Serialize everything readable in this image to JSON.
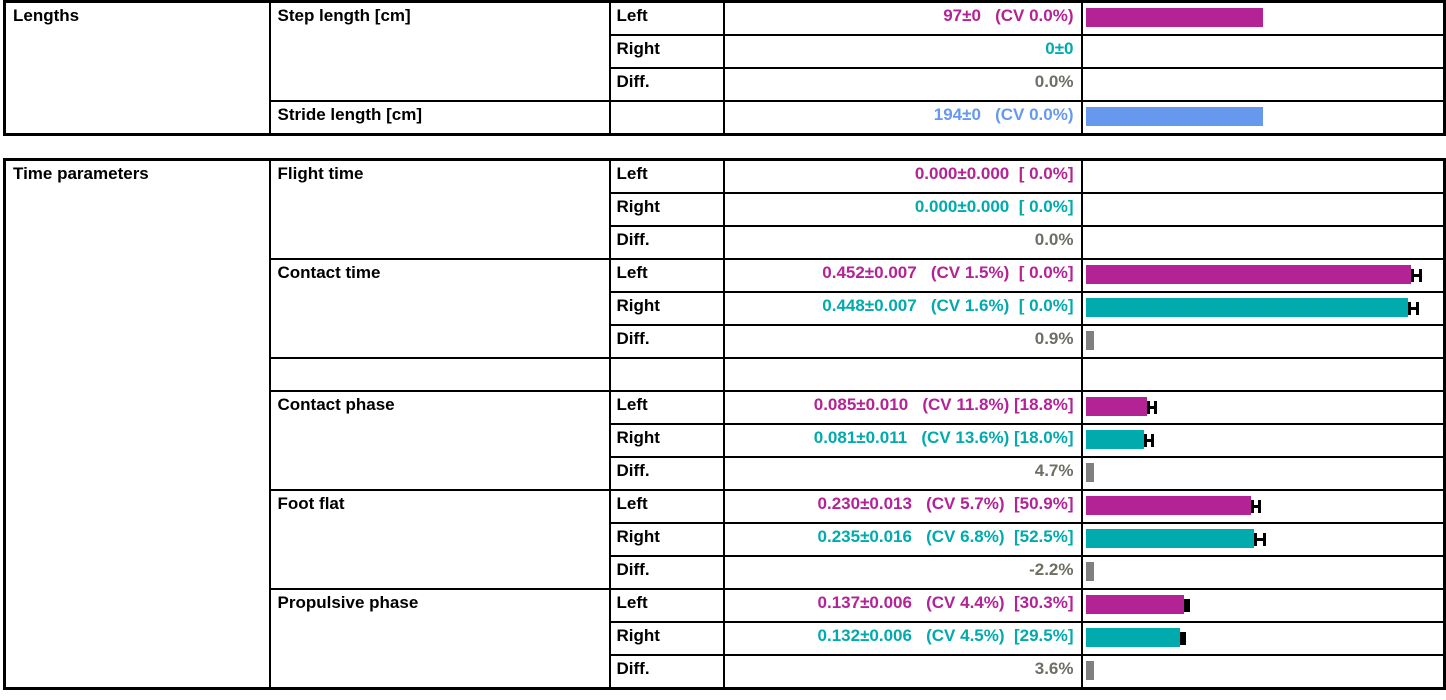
{
  "tables": [
    {
      "id": "lengths",
      "group_label": "Lengths",
      "rows": [
        {
          "param": "Step length [cm]",
          "side": "Left",
          "value": "97±0   (CV 0.0%)",
          "value_class": "v-left",
          "bar": {
            "color": "magenta",
            "width_pct": 50.0,
            "err_pct": 0.0,
            "show": true
          }
        },
        {
          "param": "",
          "side": "Right",
          "value": "0±0",
          "value_class": "v-right",
          "bar": {
            "color": "teal",
            "width_pct": 0.0,
            "err_pct": 0.0,
            "show": false
          }
        },
        {
          "param": "",
          "side": "Diff.",
          "value": "0.0%",
          "value_class": "v-diff",
          "bar": {
            "color": "gray",
            "width_pct": 0.0,
            "err_pct": 0.0,
            "show": false
          }
        },
        {
          "param": "Stride length [cm]",
          "side": "",
          "value": "194±0   (CV 0.0%)",
          "value_class": "v-stride",
          "bar": {
            "color": "blue",
            "width_pct": 50.0,
            "err_pct": 0.0,
            "show": true
          }
        }
      ]
    },
    {
      "id": "time-parameters",
      "group_label": "Time parameters",
      "rows": [
        {
          "param": "Flight time",
          "side": "Left",
          "value": "0.000±0.000  [ 0.0%]",
          "value_class": "v-left",
          "bar": {
            "color": "magenta",
            "width_pct": 0.0,
            "err_pct": 0.0,
            "show": false
          }
        },
        {
          "param": "",
          "side": "Right",
          "value": "0.000±0.000  [ 0.0%]",
          "value_class": "v-right",
          "bar": {
            "color": "teal",
            "width_pct": 0.0,
            "err_pct": 0.0,
            "show": false
          }
        },
        {
          "param": "",
          "side": "Diff.",
          "value": "0.0%",
          "value_class": "v-diff",
          "bar": {
            "color": "gray",
            "width_pct": 0.0,
            "err_pct": 0.0,
            "show": false
          }
        },
        {
          "param": "Contact time",
          "side": "Left",
          "value": "0.452±0.007   (CV 1.5%)  [ 0.0%]",
          "value_class": "v-left",
          "bar": {
            "color": "magenta",
            "width_pct": 91.5,
            "err_pct": 3.2,
            "show": true
          }
        },
        {
          "param": "",
          "side": "Right",
          "value": "0.448±0.007   (CV 1.6%)  [ 0.0%]",
          "value_class": "v-right",
          "bar": {
            "color": "teal",
            "width_pct": 90.7,
            "err_pct": 3.2,
            "show": true
          }
        },
        {
          "param": "",
          "side": "Diff.",
          "value": "0.9%",
          "value_class": "v-diff",
          "bar": {
            "color": "gray",
            "width_pct": 0.9,
            "err_pct": 0.0,
            "show": true
          }
        },
        {
          "param": "",
          "side": "",
          "value": "",
          "value_class": "v-diff",
          "spacer": true,
          "bar": {
            "color": "gray",
            "width_pct": 0.0,
            "err_pct": 0.0,
            "show": false
          }
        },
        {
          "param": "Contact phase",
          "side": "Left",
          "value": "0.085±0.010   (CV 11.8%) [18.8%]",
          "value_class": "v-left",
          "bar": {
            "color": "magenta",
            "width_pct": 17.2,
            "err_pct": 3.0,
            "show": true
          }
        },
        {
          "param": "",
          "side": "Right",
          "value": "0.081±0.011   (CV 13.6%) [18.0%]",
          "value_class": "v-right",
          "bar": {
            "color": "teal",
            "width_pct": 16.4,
            "err_pct": 3.0,
            "show": true
          }
        },
        {
          "param": "",
          "side": "Diff.",
          "value": "4.7%",
          "value_class": "v-diff",
          "bar": {
            "color": "gray",
            "width_pct": 2.4,
            "err_pct": 0.0,
            "show": true
          }
        },
        {
          "param": "Foot flat",
          "side": "Left",
          "value": "0.230±0.013   (CV 5.7%)  [50.9%]",
          "value_class": "v-left",
          "bar": {
            "color": "magenta",
            "width_pct": 46.5,
            "err_pct": 2.8,
            "show": true
          }
        },
        {
          "param": "",
          "side": "Right",
          "value": "0.235±0.016   (CV 6.8%)  [52.5%]",
          "value_class": "v-right",
          "bar": {
            "color": "teal",
            "width_pct": 47.5,
            "err_pct": 3.2,
            "show": true
          }
        },
        {
          "param": "",
          "side": "Diff.",
          "value": "-2.2%",
          "value_class": "v-diff",
          "bar": {
            "color": "gray",
            "width_pct": 2.2,
            "err_pct": 0.0,
            "show": true
          }
        },
        {
          "param": "Propulsive phase",
          "side": "Left",
          "value": "0.137±0.006   (CV 4.4%)  [30.3%]",
          "value_class": "v-left",
          "bar": {
            "color": "magenta",
            "width_pct": 27.7,
            "err_pct": 1.6,
            "show": true
          }
        },
        {
          "param": "",
          "side": "Right",
          "value": "0.132±0.006   (CV 4.5%)  [29.5%]",
          "value_class": "v-right",
          "bar": {
            "color": "teal",
            "width_pct": 26.7,
            "err_pct": 1.6,
            "show": true
          }
        },
        {
          "param": "",
          "side": "Diff.",
          "value": "3.6%",
          "value_class": "v-diff",
          "bar": {
            "color": "gray",
            "width_pct": 2.0,
            "err_pct": 0.0,
            "show": true
          }
        }
      ]
    }
  ],
  "colors": {
    "left": "#B32396",
    "right": "#00AAAD",
    "diff": "#6E6E64",
    "stride": "#6699EE",
    "gray_bar": "#808080",
    "border": "#000000"
  }
}
